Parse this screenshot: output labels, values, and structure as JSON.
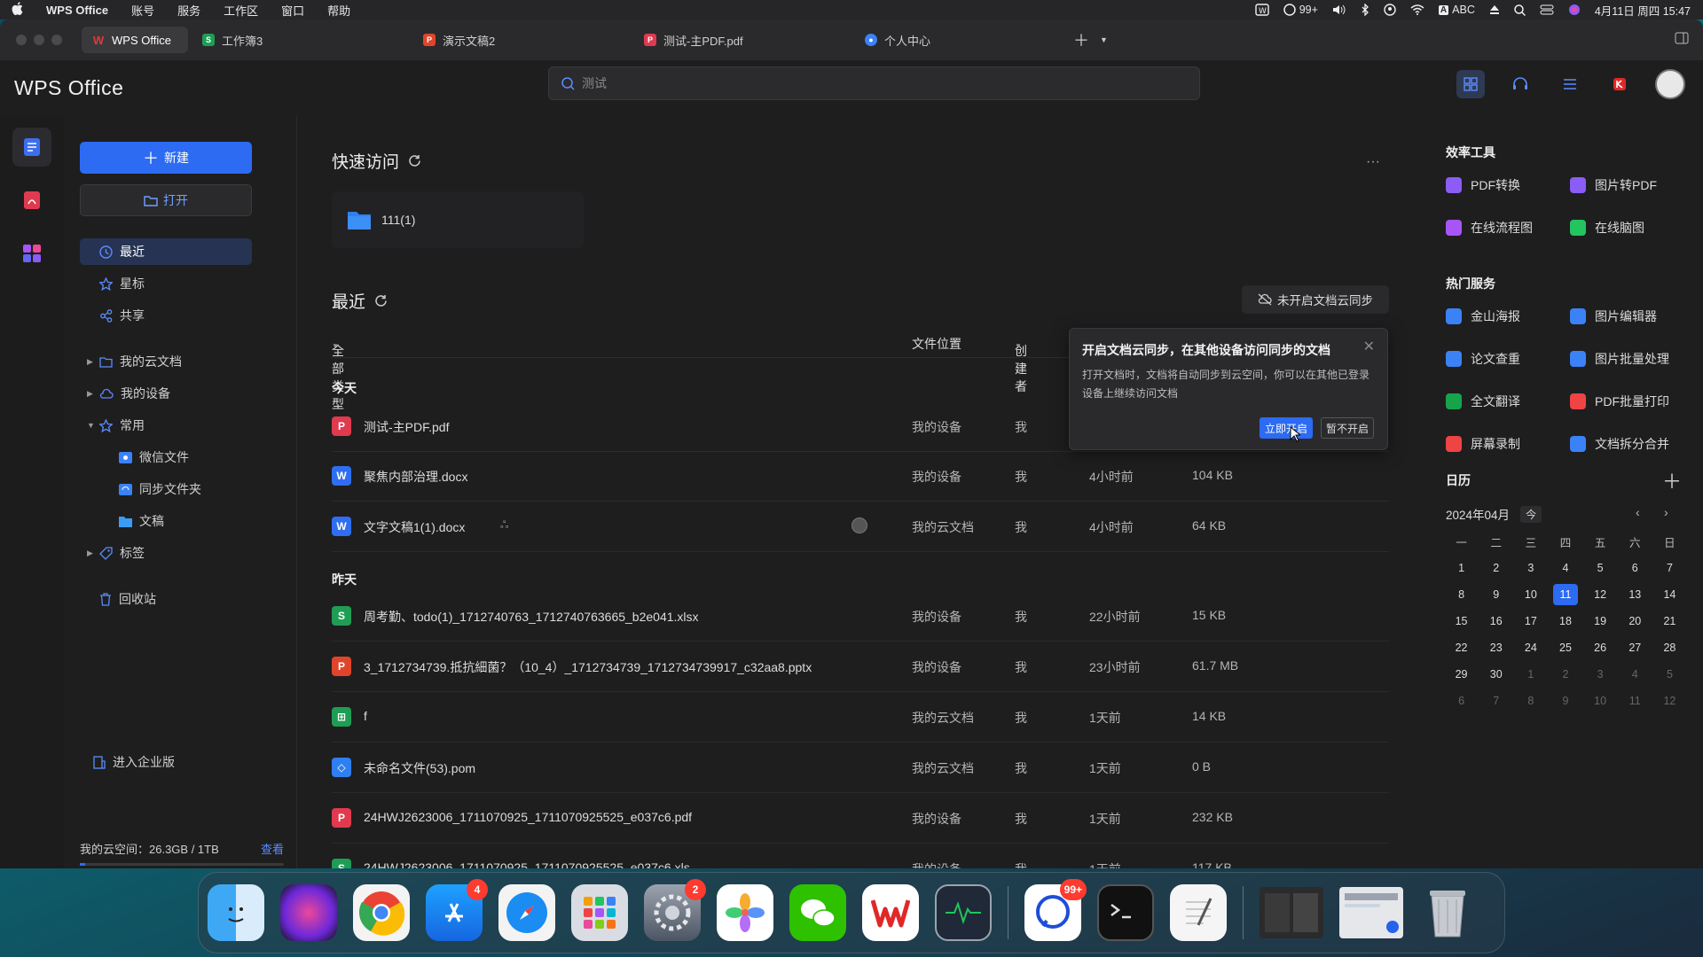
{
  "menubar": {
    "app": "WPS Office",
    "items": [
      "账号",
      "服务",
      "工作区",
      "窗口",
      "帮助"
    ],
    "status": {
      "msg_count": "99+",
      "input": "ABC",
      "datetime": "4月11日 周四 15:47"
    }
  },
  "tabs": [
    {
      "label": "WPS Office",
      "icon": "W",
      "color": "#e03a3a"
    },
    {
      "label": "工作簿3",
      "icon": "S",
      "color": "#1f9d55"
    },
    {
      "label": "演示文稿2",
      "icon": "P",
      "color": "#e0552b"
    },
    {
      "label": "测试-主PDF.pdf",
      "icon": "P",
      "color": "#e03a3a"
    },
    {
      "label": "个人中心",
      "icon": "●",
      "color": "#3b82f6"
    }
  ],
  "header": {
    "logo": "WPS Office",
    "search_text": "测试"
  },
  "sidebar": {
    "new_label": "新建",
    "open_label": "打开",
    "nav": [
      "最近",
      "星标",
      "共享",
      "我的云文档",
      "我的设备",
      "常用",
      "微信文件",
      "同步文件夹",
      "文稿",
      "标签",
      "回收站"
    ],
    "enterprise": "进入企业版",
    "storage_label": "我的云空间：26.3GB / 1TB",
    "storage_link": "查看",
    "storage_fraction": 0.026
  },
  "main": {
    "quick_title": "快速访问",
    "quick_item": "111(1)",
    "recent_title": "最近",
    "sync_button": "未开启文档云同步",
    "columns": {
      "type": "全部类型",
      "location": "文件位置",
      "creator": "创建者"
    },
    "group_today": "今天",
    "group_yesterday": "昨天",
    "rows": [
      {
        "name": "测试-主PDF.pdf",
        "icon": "P",
        "color": "#e03a4f",
        "loc": "我的设备",
        "creator": "我",
        "time": "",
        "size": ""
      },
      {
        "name": "聚焦内部治理.docx",
        "icon": "W",
        "color": "#2f6ef0",
        "loc": "我的设备",
        "creator": "我",
        "time": "4小时前",
        "size": "104 KB"
      },
      {
        "name": "文字文稿1(1).docx",
        "icon": "W",
        "color": "#2f6ef0",
        "loc": "我的云文档",
        "creator": "我",
        "time": "4小时前",
        "size": "64 KB"
      },
      {
        "name": "周考勤、todo(1)_1712740763_1712740763665_b2e041.xlsx",
        "icon": "S",
        "color": "#1f9d55",
        "loc": "我的设备",
        "creator": "我",
        "time": "22小时前",
        "size": "15 KB"
      },
      {
        "name": "3_1712734739.抵抗細菌？（10_4）_1712734739_1712734739917_c32aa8.pptx",
        "icon": "P",
        "color": "#e0452b",
        "loc": "我的设备",
        "creator": "我",
        "time": "23小时前",
        "size": "61.7 MB"
      },
      {
        "name": "f",
        "icon": "⊞",
        "color": "#1f9d55",
        "loc": "我的云文档",
        "creator": "我",
        "time": "1天前",
        "size": "14 KB"
      },
      {
        "name": "未命名文件(53).pom",
        "icon": "◇",
        "color": "#2f7ff0",
        "loc": "我的云文档",
        "creator": "我",
        "time": "1天前",
        "size": "0 B"
      },
      {
        "name": "24HWJ2623006_1711070925_1711070925525_e037c6.pdf",
        "icon": "P",
        "color": "#e03a4f",
        "loc": "我的设备",
        "creator": "我",
        "time": "1天前",
        "size": "232 KB"
      },
      {
        "name": "24HWJ2623006_1711070925_1711070925525_e037c6.xls",
        "icon": "S",
        "color": "#1f9d55",
        "loc": "我的设备",
        "creator": "我",
        "time": "1天前",
        "size": "117 KB"
      }
    ]
  },
  "popup": {
    "title": "开启文档云同步，在其他设备访问同步的文档",
    "desc": "打开文档时，文档将自动同步到云空间，你可以在其他已登录设备上继续访问文档",
    "confirm": "立即开启",
    "cancel": "暂不开启"
  },
  "rpanel": {
    "tools_title": "效率工具",
    "tools": [
      {
        "label": "PDF转换",
        "color": "#8b5cf6"
      },
      {
        "label": "图片转PDF",
        "color": "#8b5cf6"
      },
      {
        "label": "在线流程图",
        "color": "#a855f7"
      },
      {
        "label": "在线脑图",
        "color": "#22c55e"
      }
    ],
    "hot_title": "热门服务",
    "hot": [
      {
        "label": "金山海报",
        "color": "#3b82f6"
      },
      {
        "label": "图片编辑器",
        "color": "#3b82f6"
      },
      {
        "label": "论文查重",
        "color": "#3b82f6"
      },
      {
        "label": "图片批量处理",
        "color": "#3b82f6"
      },
      {
        "label": "全文翻译",
        "color": "#16a34a"
      },
      {
        "label": "PDF批量打印",
        "color": "#ef4444"
      },
      {
        "label": "屏幕录制",
        "color": "#ef4444"
      },
      {
        "label": "文档拆分合并",
        "color": "#3b82f6"
      }
    ],
    "calendar_title": "日历",
    "month": "2024年04月",
    "today_btn": "今",
    "weekdays": [
      "一",
      "二",
      "三",
      "四",
      "五",
      "六",
      "日"
    ],
    "today": "11",
    "days": [
      [
        "1",
        "2",
        "3",
        "4",
        "5",
        "6",
        "7"
      ],
      [
        "8",
        "9",
        "10",
        "11",
        "12",
        "13",
        "14"
      ],
      [
        "15",
        "16",
        "17",
        "18",
        "19",
        "20",
        "21"
      ],
      [
        "22",
        "23",
        "24",
        "25",
        "26",
        "27",
        "28"
      ],
      [
        "29",
        "30",
        "1",
        "2",
        "3",
        "4",
        "5"
      ],
      [
        "6",
        "7",
        "8",
        "9",
        "10",
        "11",
        "12"
      ]
    ]
  },
  "dock": {
    "appstore_badge": "4",
    "settings_badge": "2",
    "messages_badge": "99+"
  }
}
